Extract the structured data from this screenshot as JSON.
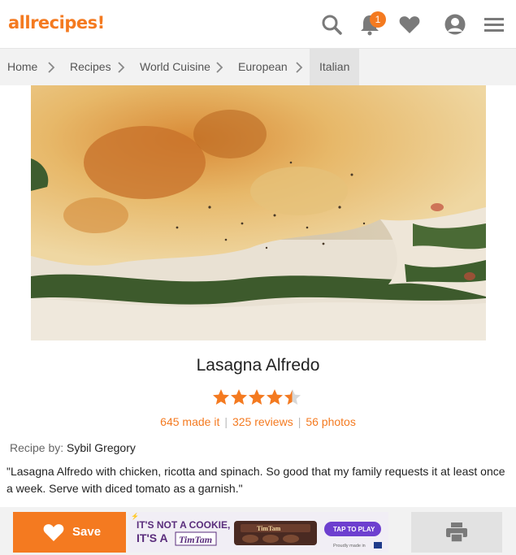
{
  "header": {
    "logo_text": "allrecipes",
    "notifications_count": "1"
  },
  "breadcrumb": [
    "Home",
    "Recipes",
    "World Cuisine",
    "European",
    "Italian"
  ],
  "recipe": {
    "title": "Lasagna Alfredo",
    "rating": 4.5,
    "made_it": "645 made it",
    "reviews": "325 reviews",
    "photos": "56 photos",
    "by_label": "Recipe by:",
    "author": "Sybil Gregory",
    "description": "\"Lasagna Alfredo with chicken, ricotta and spinach. So good that my family requests it at least once a week. Serve with diced tomato as a garnish.\""
  },
  "bottom_bar": {
    "save_label": "Save"
  },
  "ad": {
    "line1": "IT'S NOT A COOKIE,",
    "line2": "IT'S A",
    "brand": "TimTam",
    "pack_text": "TimTam",
    "cta": "TAP TO PLAY",
    "footer": "Proudly made in"
  },
  "colors": {
    "accent": "#f47a20",
    "icon_gray": "#7a7a7a"
  }
}
